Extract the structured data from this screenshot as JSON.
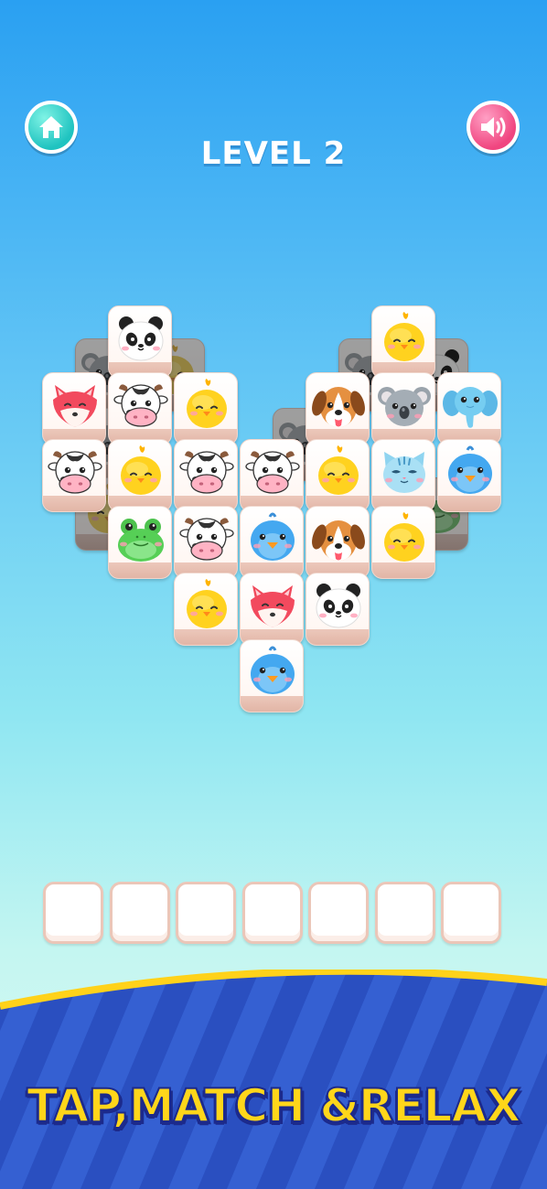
{
  "header": {
    "level_label": "LEVEL 2",
    "home_icon": "house-icon",
    "sound_icon": "speaker-icon"
  },
  "board": {
    "back_layer": [
      "koala",
      "chick",
      "koala",
      "panda",
      "koala",
      "koala",
      "chick",
      "frog"
    ],
    "top_layer": [
      [
        "panda",
        "chick"
      ],
      [
        "fox",
        "cow",
        "chick",
        "dog",
        "koala",
        "elephant"
      ],
      [
        "cow",
        "chick",
        "cow",
        "cow",
        "chick",
        "cat",
        "bird"
      ],
      [
        "frog",
        "cow",
        "bird",
        "dog",
        "chick"
      ],
      [
        "chick",
        "fox",
        "panda"
      ],
      [
        "bird"
      ]
    ]
  },
  "slot_tray": {
    "slot_count": 7,
    "filled": 0
  },
  "footer": {
    "tagline": "TAP,MATCH &RELAX"
  },
  "colors": {
    "sky_top": "#2aa0f2",
    "sky_bottom": "#dffaf3",
    "banner_blue": "#2a4fc0",
    "banner_stripe": "#3560d2",
    "banner_edge": "#ffd21a",
    "tagline_fill": "#ffd61a",
    "tagline_outline": "#1c2a8c",
    "home_button": "#1fc3c0",
    "sound_button": "#f0457f"
  }
}
